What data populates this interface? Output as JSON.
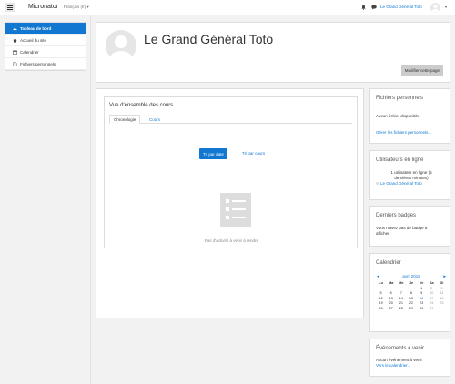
{
  "topbar": {
    "menu_icon": "hamburger-icon",
    "brand": "Micronator",
    "language": "Français (fr) ▾",
    "user_name": "Le Grand Général Toto",
    "user_caret": "▾"
  },
  "nav": {
    "items": [
      {
        "label": "Tableau de bord",
        "icon": "dashboard-icon",
        "active": true
      },
      {
        "label": "Accueil du site",
        "icon": "home-icon",
        "active": false
      },
      {
        "label": "Calendrier",
        "icon": "calendar-icon",
        "active": false
      },
      {
        "label": "Fichiers personnels",
        "icon": "file-icon",
        "active": false
      }
    ]
  },
  "header": {
    "title": "Le Grand Général Toto",
    "edit_button": "Modifier cette page"
  },
  "overview": {
    "title": "Vue d'ensemble des cours",
    "tabs": [
      "Chronologie",
      "Cours"
    ],
    "sort_by_date": "Tri par date",
    "sort_by_course": "Tri par cours",
    "empty_text": "Pas d'activité à venir à rendre"
  },
  "blocks": {
    "files": {
      "title": "Fichiers personnels",
      "text": "Aucun fichier disponible",
      "link": "Gérer les fichiers personnels..."
    },
    "online": {
      "title": "Utilisateurs en ligne",
      "line1": "1 utilisateur en ligne (5",
      "line2": "dernières minutes)",
      "user": "Le Grand Général Toto"
    },
    "badges": {
      "title": "Derniers badges",
      "line1": "Vous n'avez pas de badge à",
      "line2": "afficher"
    },
    "calendar": {
      "title": "Calendrier",
      "prev": "◄",
      "month": "avril 2019",
      "next": "►",
      "day_headers": [
        "Lu",
        "Ma",
        "Me",
        "Je",
        "Ve",
        "Sa",
        "Di"
      ],
      "weeks": [
        [
          "",
          "",
          "",
          "",
          "1",
          "2",
          "3"
        ],
        [
          "5",
          "6",
          "7",
          "8",
          "9",
          "10",
          "11"
        ],
        [
          "12",
          "13",
          "14",
          "15",
          "16",
          "17",
          "18"
        ],
        [
          "19",
          "20",
          "21",
          "22",
          "23",
          "24",
          "25"
        ],
        [
          "26",
          "27",
          "28",
          "29",
          "30",
          "31",
          ""
        ]
      ]
    },
    "events": {
      "title": "Événements à venir",
      "text": "Aucun événement à venir",
      "link": "Vers le calendrier..."
    }
  },
  "colors": {
    "accent": "#1177d1",
    "background": "#f2f2f2"
  }
}
